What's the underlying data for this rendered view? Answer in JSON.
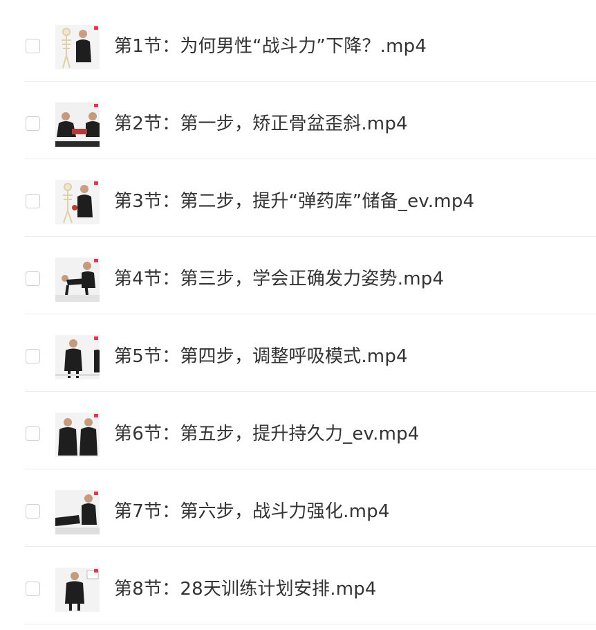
{
  "files": [
    {
      "name": "第1节：为何男性“战斗力”下降？.mp4",
      "thumbnail_icon": "video-thumbnail-icon"
    },
    {
      "name": "第2节：第一步，矫正骨盆歪斜.mp4",
      "thumbnail_icon": "video-thumbnail-icon"
    },
    {
      "name": "第3节：第二步，提升“弹药库”储备_ev.mp4",
      "thumbnail_icon": "video-thumbnail-icon"
    },
    {
      "name": "第4节：第三步，学会正确发力姿势.mp4",
      "thumbnail_icon": "video-thumbnail-icon"
    },
    {
      "name": "第5节：第四步，调整呼吸模式.mp4",
      "thumbnail_icon": "video-thumbnail-icon"
    },
    {
      "name": "第6节：第五步，提升持久力_ev.mp4",
      "thumbnail_icon": "video-thumbnail-icon"
    },
    {
      "name": "第7节：第六步，战斗力强化.mp4",
      "thumbnail_icon": "video-thumbnail-icon"
    },
    {
      "name": "第8节：28天训练计划安排.mp4",
      "thumbnail_icon": "video-thumbnail-icon"
    }
  ],
  "colors": {
    "text": "#333333",
    "divider": "#ececec",
    "checkbox_border": "#cfcfcf",
    "accent_mark": "#e8344e"
  }
}
